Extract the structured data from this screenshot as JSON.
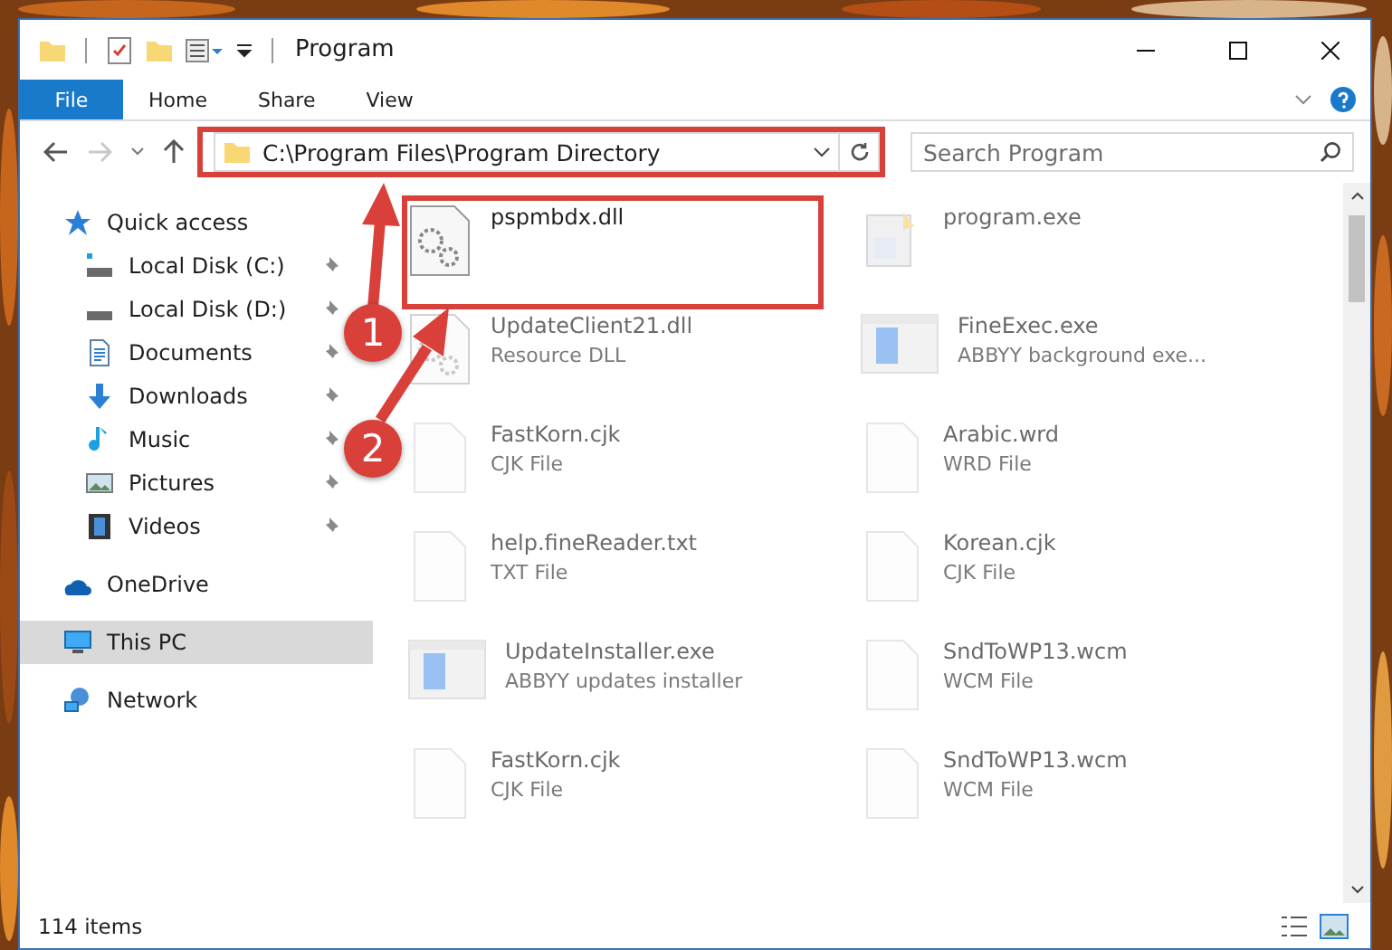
{
  "window": {
    "title": "Program"
  },
  "ribbon_tabs": [
    {
      "label": "File",
      "selected": true
    },
    {
      "label": "Home",
      "selected": false
    },
    {
      "label": "Share",
      "selected": false
    },
    {
      "label": "View",
      "selected": false
    }
  ],
  "address_bar": {
    "path": "C:\\Program Files\\Program Directory",
    "highlighted": true
  },
  "search": {
    "placeholder": "Search Program"
  },
  "sidebar": {
    "items": [
      {
        "label": "Quick access",
        "kind": "star",
        "selected": false,
        "children": [
          {
            "label": "Local Disk (C:)",
            "kind": "drive-c",
            "pinned": true,
            "selected": false
          },
          {
            "label": "Local Disk (D:)",
            "kind": "drive",
            "pinned": true,
            "selected": false
          },
          {
            "label": "Documents",
            "kind": "docs",
            "pinned": true,
            "selected": false
          },
          {
            "label": "Downloads",
            "kind": "download",
            "pinned": true,
            "selected": false
          },
          {
            "label": "Music",
            "kind": "music",
            "pinned": true,
            "selected": false
          },
          {
            "label": "Pictures",
            "kind": "pictures",
            "pinned": true,
            "selected": false
          },
          {
            "label": "Videos",
            "kind": "videos",
            "pinned": true,
            "selected": false
          }
        ]
      },
      {
        "label": "OneDrive",
        "kind": "cloud",
        "selected": false
      },
      {
        "label": "This PC",
        "kind": "pc",
        "selected": true
      },
      {
        "label": "Network",
        "kind": "network",
        "selected": false
      }
    ]
  },
  "files": [
    {
      "name": "pspmbdx.dll",
      "kind": "gear-doc",
      "dimmed": false,
      "highlighted": true
    },
    {
      "name": "program.exe",
      "kind": "program",
      "dimmed": true,
      "highlighted": false
    },
    {
      "name": "UpdateClient21.dll",
      "type": "Resource DLL",
      "kind": "gear-doc",
      "dimmed": true,
      "highlighted": false
    },
    {
      "name": "FineExec.exe",
      "type": "ABBYY background exe...",
      "kind": "app",
      "dimmed": true,
      "highlighted": false
    },
    {
      "name": "FastKorn.cjk",
      "type": "CJK File",
      "kind": "blank",
      "dimmed": true,
      "highlighted": false
    },
    {
      "name": "Arabic.wrd",
      "type": "WRD File",
      "kind": "blank",
      "dimmed": true,
      "highlighted": false
    },
    {
      "name": "help.fineReader.txt",
      "type": "TXT File",
      "kind": "blank",
      "dimmed": true,
      "highlighted": false
    },
    {
      "name": "Korean.cjk",
      "type": "CJK File",
      "kind": "blank",
      "dimmed": true,
      "highlighted": false
    },
    {
      "name": "UpdateInstaller.exe",
      "type": "ABBYY updates installer",
      "kind": "app",
      "dimmed": true,
      "highlighted": false
    },
    {
      "name": "SndToWP13.wcm",
      "type": "WCM File",
      "kind": "blank",
      "dimmed": true,
      "highlighted": false
    },
    {
      "name": "FastKorn.cjk",
      "type": "CJK File",
      "kind": "blank",
      "dimmed": true,
      "highlighted": false
    },
    {
      "name": "SndToWP13.wcm",
      "type": "WCM File",
      "kind": "blank",
      "dimmed": true,
      "highlighted": false
    }
  ],
  "status_bar": {
    "item_count": "114 items"
  },
  "callouts": [
    {
      "number": "1"
    },
    {
      "number": "2"
    }
  ]
}
